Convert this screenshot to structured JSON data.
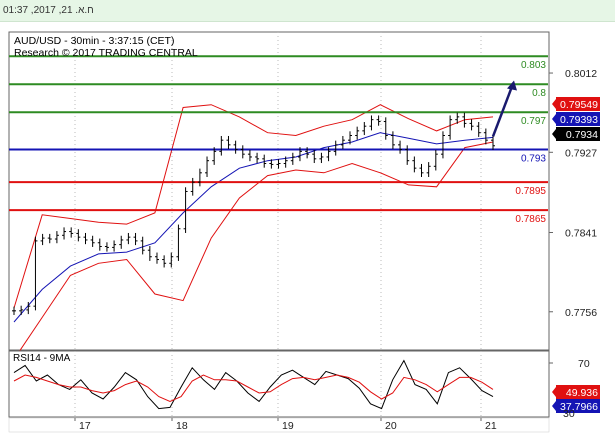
{
  "timestamp": "ח.א. 21, 2017, 01:37",
  "chart_data": [
    {
      "type": "line",
      "title": "AUD/USD - 30min - 3:37:15 (CET)",
      "subtitle": "Research © 2017 TRADING CENTRAL",
      "xlabel": "",
      "ylabel": "",
      "x_ticks": [
        "17",
        "18",
        "19",
        "20",
        "21"
      ],
      "y_ticks": [
        0.8012,
        0.7927,
        0.7841,
        0.7756
      ],
      "ylim": [
        0.7715,
        0.8056
      ],
      "levels": [
        {
          "label": "0.803",
          "value": 0.803,
          "color": "#2e8b22"
        },
        {
          "label": "0.8",
          "value": 0.8,
          "color": "#2e8b22"
        },
        {
          "label": "0.797",
          "value": 0.797,
          "color": "#2e8b22"
        },
        {
          "label": "0.793",
          "value": 0.793,
          "color": "#1414b4"
        },
        {
          "label": "0.7895",
          "value": 0.7895,
          "color": "#e01010"
        },
        {
          "label": "0.7865",
          "value": 0.7865,
          "color": "#e01010"
        }
      ],
      "price_tags": [
        {
          "text": "0.79549",
          "bg": "#e01010",
          "fg": "#ffffff"
        },
        {
          "text": "0.79393",
          "bg": "#1414b4",
          "fg": "#ffffff"
        },
        {
          "text": "0.7934",
          "bg": "#000000",
          "fg": "#ffffff"
        }
      ],
      "close_series": [
        [
          "17",
          0.7757
        ],
        [
          "17",
          0.7758
        ],
        [
          "17",
          0.7762
        ],
        [
          "17",
          0.7832
        ],
        [
          "17",
          0.7835
        ],
        [
          "17",
          0.7834
        ],
        [
          "17",
          0.7838
        ],
        [
          "17",
          0.7842
        ],
        [
          "17",
          0.784
        ],
        [
          "17",
          0.7836
        ],
        [
          "17",
          0.7833
        ],
        [
          "17",
          0.783
        ],
        [
          "17",
          0.7826
        ],
        [
          "17",
          0.7825
        ],
        [
          "17",
          0.7828
        ],
        [
          "17",
          0.7833
        ],
        [
          "17",
          0.7836
        ],
        [
          "17",
          0.7832
        ],
        [
          "18",
          0.7822
        ],
        [
          "18",
          0.7815
        ],
        [
          "18",
          0.7812
        ],
        [
          "18",
          0.7808
        ],
        [
          "18",
          0.7815
        ],
        [
          "18",
          0.7845
        ],
        [
          "18",
          0.7885
        ],
        [
          "18",
          0.7895
        ],
        [
          "18",
          0.7905
        ],
        [
          "18",
          0.7918
        ],
        [
          "18",
          0.7928
        ],
        [
          "18",
          0.794
        ],
        [
          "18",
          0.7935
        ],
        [
          "18",
          0.793
        ],
        [
          "18",
          0.7925
        ],
        [
          "18",
          0.7922
        ],
        [
          "19",
          0.792
        ],
        [
          "19",
          0.7915
        ],
        [
          "19",
          0.7914
        ],
        [
          "19",
          0.7915
        ],
        [
          "19",
          0.7918
        ],
        [
          "19",
          0.7922
        ],
        [
          "19",
          0.7928
        ],
        [
          "19",
          0.7925
        ],
        [
          "19",
          0.792
        ],
        [
          "19",
          0.7922
        ],
        [
          "19",
          0.7928
        ],
        [
          "19",
          0.7935
        ],
        [
          "19",
          0.794
        ],
        [
          "19",
          0.7945
        ],
        [
          "19",
          0.795
        ],
        [
          "19",
          0.7955
        ],
        [
          "20",
          0.7962
        ],
        [
          "20",
          0.796
        ],
        [
          "20",
          0.7945
        ],
        [
          "20",
          0.7935
        ],
        [
          "20",
          0.793
        ],
        [
          "20",
          0.7918
        ],
        [
          "20",
          0.791
        ],
        [
          "20",
          0.7905
        ],
        [
          "20",
          0.7912
        ],
        [
          "20",
          0.7925
        ],
        [
          "20",
          0.7945
        ],
        [
          "20",
          0.7962
        ],
        [
          "20",
          0.7965
        ],
        [
          "20",
          0.7958
        ],
        [
          "20",
          0.7955
        ],
        [
          "21",
          0.7948
        ],
        [
          "21",
          0.794
        ],
        [
          "21",
          0.7934
        ]
      ],
      "bb_upper": [
        0.776,
        0.786,
        0.7856,
        0.7852,
        0.785,
        0.7862,
        0.7975,
        0.7978,
        0.7965,
        0.7948,
        0.7945,
        0.7955,
        0.7962,
        0.7978,
        0.7963,
        0.795,
        0.7962,
        0.7965
      ],
      "bb_lower": [
        0.7705,
        0.775,
        0.7795,
        0.7808,
        0.7812,
        0.7775,
        0.7768,
        0.7835,
        0.7878,
        0.7902,
        0.7908,
        0.7905,
        0.7915,
        0.7905,
        0.7892,
        0.789,
        0.7932,
        0.7938
      ],
      "ma_blue": [
        0.7745,
        0.778,
        0.7805,
        0.7818,
        0.782,
        0.783,
        0.7862,
        0.789,
        0.791,
        0.7918,
        0.7922,
        0.7932,
        0.7938,
        0.7948,
        0.7942,
        0.7936,
        0.794,
        0.7943
      ],
      "forecast_arrow": {
        "from": 0.7944,
        "to": 0.8004
      }
    },
    {
      "type": "line",
      "title": "RSI14 - 9MA",
      "ylim": [
        25,
        80
      ],
      "y_ticks": [
        70
      ],
      "series": [
        {
          "color": "#000000",
          "values": [
            62,
            68,
            55,
            60,
            52,
            48,
            56,
            45,
            40,
            50,
            62,
            56,
            42,
            32,
            33,
            50,
            66,
            56,
            48,
            62,
            55,
            45,
            38,
            50,
            60,
            64,
            58,
            52,
            63,
            60,
            57,
            49,
            36,
            32,
            56,
            72,
            52,
            48,
            36,
            62,
            66,
            57,
            47,
            42
          ]
        },
        {
          "color": "#e01010",
          "values": [
            55,
            60,
            58,
            55,
            52,
            50,
            50,
            47,
            45,
            47,
            52,
            55,
            50,
            42,
            38,
            42,
            55,
            60,
            56,
            56,
            55,
            50,
            45,
            46,
            52,
            57,
            58,
            56,
            58,
            60,
            58,
            54,
            46,
            40,
            45,
            58,
            56,
            52,
            46,
            52,
            58,
            58,
            54,
            48
          ]
        }
      ],
      "value_tags": [
        {
          "text": "49.936",
          "bg": "#e01010",
          "fg": "#ffffff"
        },
        {
          "text": "37.7966",
          "bg": "#1414b4",
          "fg": "#ffffff"
        },
        {
          "text": "30",
          "bg": "",
          "fg": "#222222"
        }
      ]
    }
  ]
}
